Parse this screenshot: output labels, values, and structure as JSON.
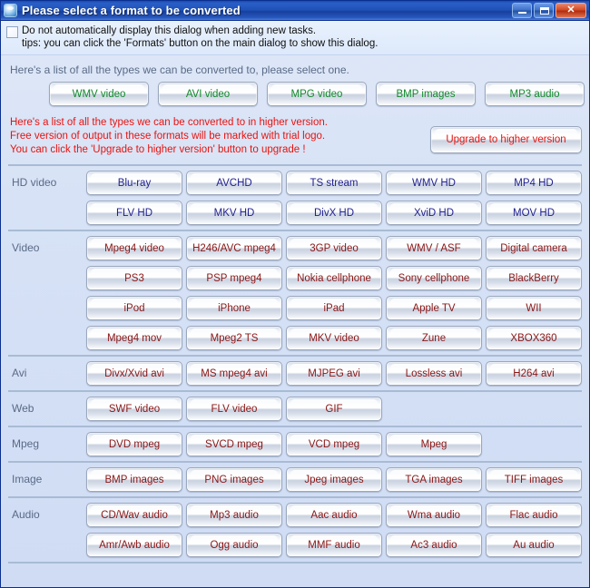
{
  "window": {
    "title": "Please select a format to be converted",
    "icon": "app-shield-icon",
    "controls": {
      "minimize": "minimize-button",
      "maximize": "maximize-button",
      "close_label": "✕"
    }
  },
  "notice": {
    "checkbox_checked": false,
    "line1": "Do not automatically display this dialog when adding new tasks.",
    "line2": "tips: you can click the 'Formats' button on the main dialog to show this dialog."
  },
  "intro": "Here's a list of all the types we can be converted to, please select one.",
  "top_formats": [
    {
      "label": "WMV video"
    },
    {
      "label": "AVI video"
    },
    {
      "label": "MPG video"
    },
    {
      "label": "BMP images"
    },
    {
      "label": "MP3 audio"
    }
  ],
  "upgrade": {
    "line1": "Here's a list of all the types we can be converted to in higher version.",
    "line2": "Free version of output in these formats will be marked with trial logo.",
    "line3": "You can click the 'Upgrade to higher version' button to upgrade !",
    "button_label": "Upgrade to higher version"
  },
  "colors": {
    "titlebar_blue": "#1f51b6",
    "green_text": "#11892b",
    "navy_text": "#1f1f8e",
    "dark_red_text": "#8a1616",
    "bright_red_text": "#e8130f",
    "label_gray": "#5a6a86",
    "body_background": "#d7e2f6",
    "rule_color": "#a9bbd4"
  },
  "sections": [
    {
      "label": "HD video",
      "text_style": "navy",
      "rows": [
        [
          "Blu-ray",
          "AVCHD",
          "TS stream",
          "WMV HD",
          "MP4 HD"
        ],
        [
          "FLV HD",
          "MKV HD",
          "DivX HD",
          "XviD HD",
          "MOV HD"
        ]
      ]
    },
    {
      "label": "Video",
      "text_style": "red",
      "rows": [
        [
          "Mpeg4 video",
          "H246/AVC mpeg4",
          "3GP video",
          "WMV / ASF",
          "Digital camera"
        ],
        [
          "PS3",
          "PSP mpeg4",
          "Nokia cellphone",
          "Sony cellphone",
          "BlackBerry"
        ],
        [
          "iPod",
          "iPhone",
          "iPad",
          "Apple TV",
          "WII"
        ],
        [
          "Mpeg4 mov",
          "Mpeg2 TS",
          "MKV video",
          "Zune",
          "XBOX360"
        ]
      ]
    },
    {
      "label": "Avi",
      "text_style": "red",
      "rows": [
        [
          "Divx/Xvid avi",
          "MS mpeg4 avi",
          "MJPEG avi",
          "Lossless avi",
          "H264 avi"
        ]
      ]
    },
    {
      "label": "Web",
      "text_style": "red",
      "rows": [
        [
          "SWF video",
          "FLV video",
          "GIF"
        ]
      ]
    },
    {
      "label": "Mpeg",
      "text_style": "red",
      "rows": [
        [
          "DVD mpeg",
          "SVCD mpeg",
          "VCD mpeg",
          "Mpeg"
        ]
      ]
    },
    {
      "label": "Image",
      "text_style": "red",
      "rows": [
        [
          "BMP images",
          "PNG images",
          "Jpeg images",
          "TGA images",
          "TIFF images"
        ]
      ]
    },
    {
      "label": "Audio",
      "text_style": "red",
      "rows": [
        [
          "CD/Wav audio",
          "Mp3 audio",
          "Aac audio",
          "Wma audio",
          "Flac audio"
        ],
        [
          "Amr/Awb audio",
          "Ogg audio",
          "MMF audio",
          "Ac3 audio",
          "Au audio"
        ]
      ]
    }
  ]
}
